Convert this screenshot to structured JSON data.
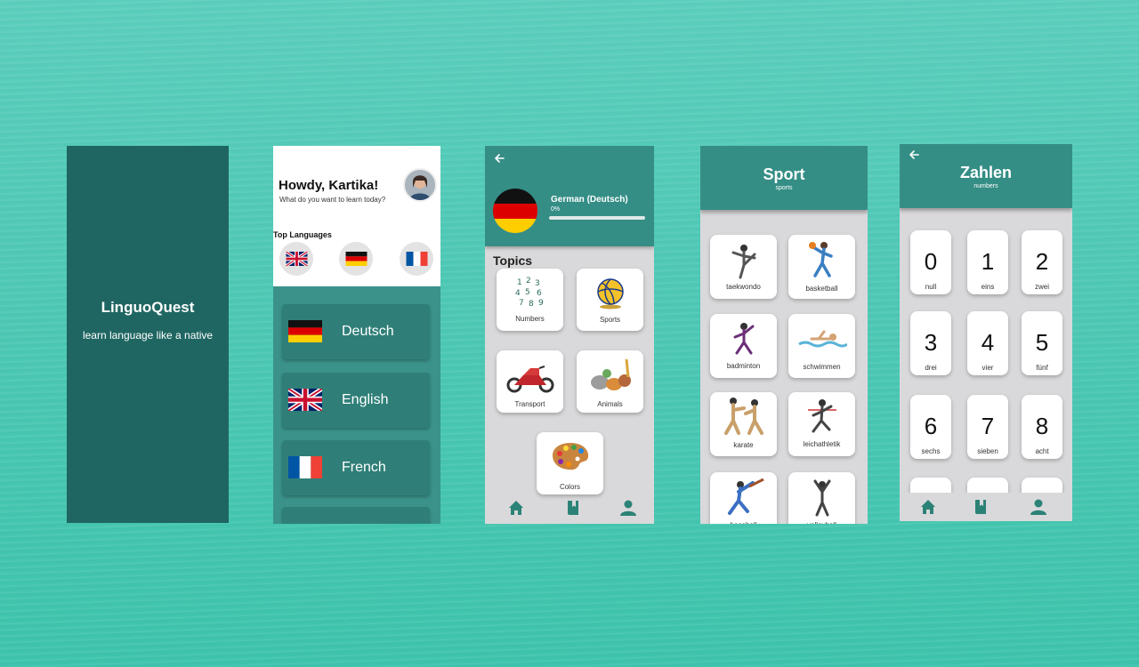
{
  "colors": {
    "teal": "#358e85",
    "dark_teal": "#1f6662",
    "gray": "#d9d9db",
    "background": "#4fc9b6"
  },
  "splash": {
    "title": "LinguoQuest",
    "tagline": "learn language like a native"
  },
  "home": {
    "greeting": "Howdy, Kartika!",
    "question": "What do you want to learn today?",
    "top_languages_label": "Top Languages",
    "languages": [
      {
        "name": "Deutsch",
        "flag": "germany-flag"
      },
      {
        "name": "English",
        "flag": "uk-flag"
      },
      {
        "name": "French",
        "flag": "france-flag"
      }
    ]
  },
  "course": {
    "language": "German (Deutsch)",
    "progress_text": "0%",
    "progress": 0,
    "topics_label": "Topics",
    "topics": [
      "Numbers",
      "Sports",
      "Transport",
      "Animals",
      "Colors"
    ]
  },
  "sport": {
    "title": "Sport",
    "subtitle": "sports",
    "items": [
      "taekwondo",
      "basketball",
      "badminton",
      "schwimmen",
      "karate",
      "leichathletik",
      "baseball",
      "volleyball"
    ]
  },
  "zahlen": {
    "title": "Zahlen",
    "subtitle": "numbers",
    "items": [
      {
        "digit": "0",
        "word": "null"
      },
      {
        "digit": "1",
        "word": "eins"
      },
      {
        "digit": "2",
        "word": "zwei"
      },
      {
        "digit": "3",
        "word": "drei"
      },
      {
        "digit": "4",
        "word": "vier"
      },
      {
        "digit": "5",
        "word": "fünf"
      },
      {
        "digit": "6",
        "word": "sechs"
      },
      {
        "digit": "7",
        "word": "sieben"
      },
      {
        "digit": "8",
        "word": "acht"
      }
    ]
  },
  "nav_icons": [
    "home-icon",
    "book-icon",
    "profile-icon"
  ]
}
